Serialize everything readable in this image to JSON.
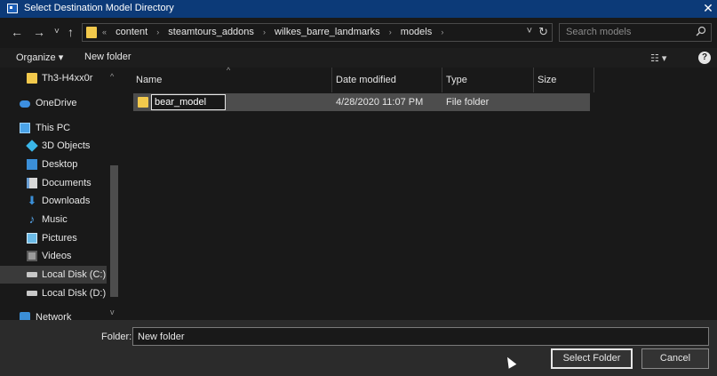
{
  "window": {
    "title": "Select Destination Model Directory",
    "close_glyph": "✕"
  },
  "nav": {
    "back": "←",
    "forward": "→",
    "recent": "˅",
    "up": "↑"
  },
  "address": {
    "overflow": "«",
    "crumbs": [
      "content",
      "steamtours_addons",
      "wilkes_barre_landmarks",
      "models"
    ],
    "separator": "›",
    "dropdown": "˅",
    "refresh": "↻"
  },
  "search": {
    "placeholder": "Search models",
    "icon": "search-icon"
  },
  "toolbar": {
    "organize": "Organize ▾",
    "new_folder": "New folder",
    "view": "☷ ▾",
    "help": "?"
  },
  "sidebar": {
    "items": [
      {
        "label": "Th3-H4xx0r",
        "icon": "folder-icon"
      },
      {
        "label": "OneDrive",
        "icon": "cloud-icon"
      },
      {
        "label": "This PC",
        "icon": "computer-icon"
      },
      {
        "label": "3D Objects",
        "icon": "3d-objects-icon"
      },
      {
        "label": "Desktop",
        "icon": "desktop-icon"
      },
      {
        "label": "Documents",
        "icon": "documents-icon"
      },
      {
        "label": "Downloads",
        "icon": "downloads-icon"
      },
      {
        "label": "Music",
        "icon": "music-icon"
      },
      {
        "label": "Pictures",
        "icon": "pictures-icon"
      },
      {
        "label": "Videos",
        "icon": "videos-icon"
      },
      {
        "label": "Local Disk (C:)",
        "icon": "drive-icon",
        "selected": true
      },
      {
        "label": "Local Disk (D:)",
        "icon": "drive-icon"
      },
      {
        "label": "Network",
        "icon": "network-icon"
      }
    ],
    "scroll_up": "^",
    "scroll_down": "v"
  },
  "columns": {
    "name": "Name",
    "date": "Date modified",
    "type": "Type",
    "size": "Size",
    "sort_indicator": "^"
  },
  "files": [
    {
      "name": "bear_model",
      "date": "4/28/2020 11:07 PM",
      "type": "File folder",
      "size": ""
    }
  ],
  "footer": {
    "folder_label": "Folder:",
    "folder_value": "New folder",
    "select_button": "Select Folder",
    "cancel_button": "Cancel"
  },
  "colors": {
    "titlebar": "#0c3a78",
    "background": "#191919",
    "folder": "#f2c94c",
    "selection": "#4d4d4d"
  }
}
